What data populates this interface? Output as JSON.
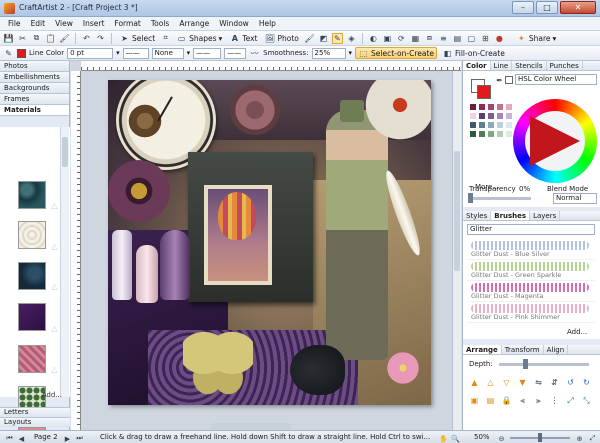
{
  "window": {
    "title": "CraftArtist 2 - [Craft Project 3 *]",
    "minimize_label": "–",
    "maximize_label": "□",
    "close_label": "✕"
  },
  "menu": [
    "File",
    "Edit",
    "View",
    "Insert",
    "Format",
    "Tools",
    "Arrange",
    "Window",
    "Help"
  ],
  "toolbar": {
    "select_label": "Select",
    "shapes_label": "Shapes",
    "text_label": "Text",
    "photo_label": "Photo",
    "share_label": "Share"
  },
  "context_toolbar": {
    "line_color_label": "Line Color",
    "line_width_value": "0 pt",
    "line_style_value": "None",
    "smoothness_label": "Smoothness:",
    "smoothness_value": "25%",
    "select_on_create_label": "Select-on-Create",
    "fill_on_create_label": "Fill-on-Create"
  },
  "left_panel": {
    "tabs": [
      "Photos",
      "Embellishments",
      "Backgrounds",
      "Frames",
      "Materials"
    ],
    "active_tab": "Materials",
    "add_label": "Add...",
    "bottom_tabs": [
      "Letters",
      "Layouts"
    ]
  },
  "right_panel": {
    "color_tabs": [
      "Color",
      "Line",
      "Stencils",
      "Punches"
    ],
    "color_mode": "HSL Color Wheel",
    "more_label": "More...",
    "transparency_label": "Transparency",
    "transparency_value": "0%",
    "blend_mode_label": "Blend Mode",
    "blend_mode_value": "Normal",
    "brush_tabs": [
      "Styles",
      "Brushes",
      "Layers"
    ],
    "brush_category": "Glitter",
    "brushes": [
      "Glitter Dust - Blue Silver",
      "Glitter Dust - Green Sparkle",
      "Glitter Dust - Magenta",
      "Glitter Dust - Pink Shimmer"
    ],
    "brush_colors": [
      "#9fb3d8",
      "#a6c97a",
      "#d04b9a",
      "#e79ab8"
    ],
    "add_label": "Add...",
    "arrange_tabs": [
      "Arrange",
      "Transform",
      "Align"
    ],
    "depth_label": "Depth:"
  },
  "status_bar": {
    "page_label": "Page 2",
    "hint": "Click & drag to draw a freehand line. Hold down Shift to draw a straight line. Hold Ctrl to swi...",
    "zoom_value": "50%"
  },
  "colors": {
    "accent_red": "#e21a1a",
    "palette": [
      "#6b1f3a",
      "#8b2d4e",
      "#a8456a",
      "#c9708e",
      "#e3a8ba",
      "#f2d3dc",
      "#5a3f6e",
      "#7d5f94",
      "#a386b5",
      "#c9b4d6",
      "#3c5c6e",
      "#5d8194",
      "#8aabbd",
      "#b9d1dd",
      "#d9e7ee",
      "#2f5a3a",
      "#4f7d58",
      "#7fa786",
      "#b2cdb6",
      "#dfeadf"
    ]
  }
}
